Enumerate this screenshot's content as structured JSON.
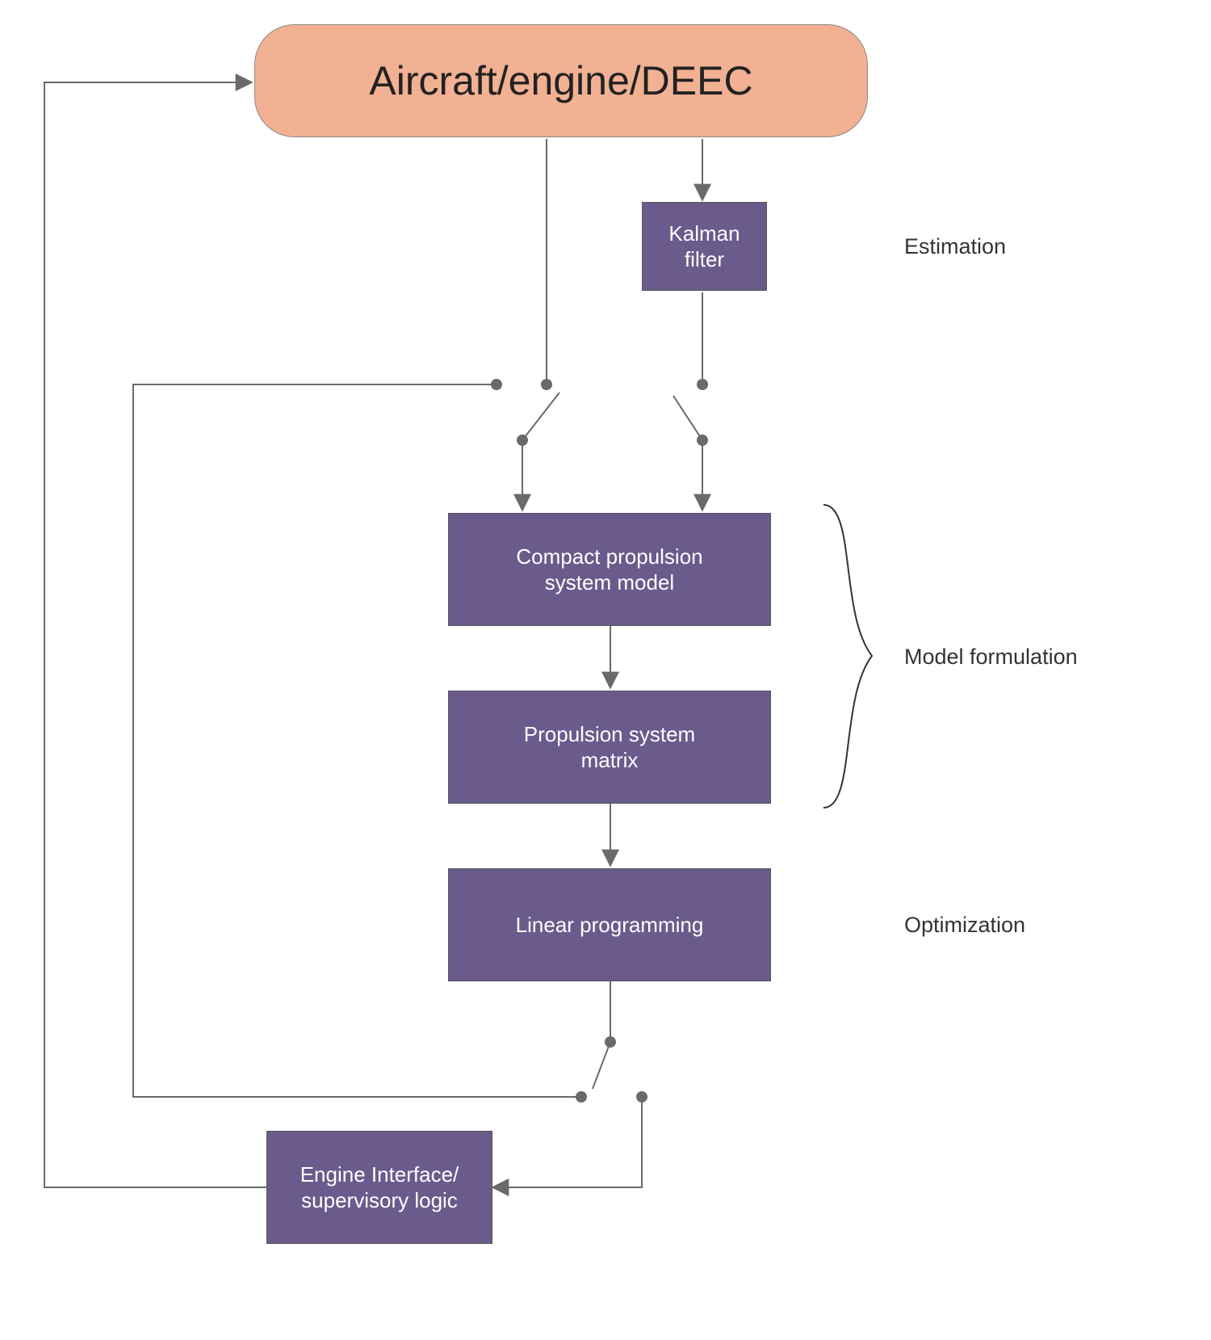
{
  "nodes": {
    "aircraft": "Aircraft/engine/DEEC",
    "kalman": "Kalman\nfilter",
    "compact": "Compact propulsion\nsystem model",
    "matrix": "Propulsion system\nmatrix",
    "linear": "Linear programming",
    "engine_if": "Engine Interface/\nsupervisory logic"
  },
  "labels": {
    "estimation": "Estimation",
    "model_formulation": "Model formulation",
    "optimization": "Optimization"
  },
  "colors": {
    "top_fill": "#f2b193",
    "block_fill": "#6a5b8c",
    "text_dark": "#222222",
    "text_light": "#ffffff",
    "arrow": "#6a6a6a"
  }
}
